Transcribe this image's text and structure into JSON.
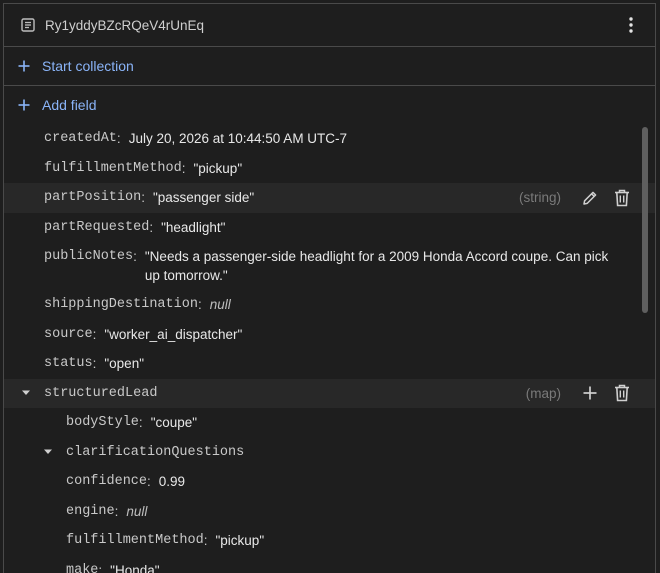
{
  "document": {
    "id": "Ry1yddyBZcRQeV4rUnEq"
  },
  "actions": {
    "start_collection": "Start collection",
    "add_field": "Add field"
  },
  "fields": {
    "createdAt": {
      "key": "createdAt",
      "value": "July 20, 2026 at 10:44:50 AM UTC-7"
    },
    "fulfillmentMethod": {
      "key": "fulfillmentMethod",
      "value": "\"pickup\""
    },
    "partPosition": {
      "key": "partPosition",
      "value": "\"passenger side\"",
      "type": "(string)"
    },
    "partRequested": {
      "key": "partRequested",
      "value": "\"headlight\""
    },
    "publicNotes": {
      "key": "publicNotes",
      "value": "\"Needs a passenger-side headlight for a 2009 Honda Accord coupe. Can pick up tomorrow.\""
    },
    "shippingDestination": {
      "key": "shippingDestination",
      "value": "null"
    },
    "source": {
      "key": "source",
      "value": "\"worker_ai_dispatcher\""
    },
    "status": {
      "key": "status",
      "value": "\"open\""
    },
    "structuredLead": {
      "key": "structuredLead",
      "type": "(map)",
      "children": {
        "bodyStyle": {
          "key": "bodyStyle",
          "value": "\"coupe\""
        },
        "clarificationQuestions": {
          "key": "clarificationQuestions"
        },
        "confidence": {
          "key": "confidence",
          "value": "0.99"
        },
        "engine": {
          "key": "engine",
          "value": "null"
        },
        "fulfillmentMethod": {
          "key": "fulfillmentMethod",
          "value": "\"pickup\""
        },
        "make": {
          "key": "make",
          "value": "\"Honda\""
        }
      }
    }
  },
  "colors": {
    "accent": "#8ab4f8",
    "background": "#1e1e1e",
    "border": "#4a4a4a",
    "highlight": "#282828"
  },
  "icons": {
    "doc": "document-icon",
    "menu": "more-vert-icon",
    "plus": "plus-icon",
    "edit": "pencil-icon",
    "delete": "trash-icon",
    "expand": "caret-down-icon"
  }
}
